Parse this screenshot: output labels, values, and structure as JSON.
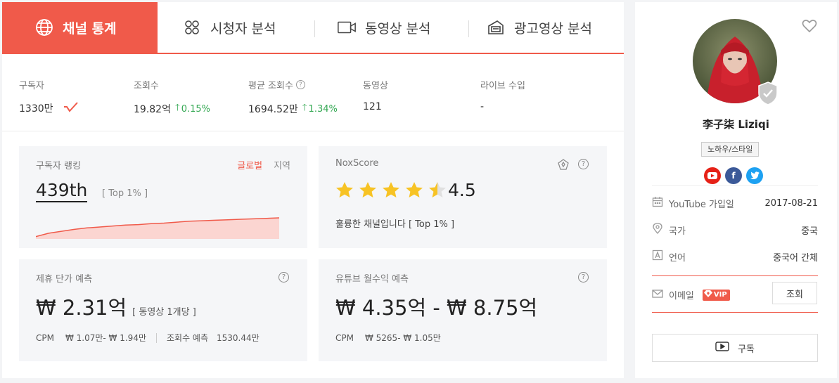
{
  "tabs": [
    {
      "label": "채널 통계",
      "icon": "globe-icon",
      "active": true
    },
    {
      "label": "시청자 분석",
      "icon": "audience-icon"
    },
    {
      "label": "동영상 분석",
      "icon": "video-icon"
    },
    {
      "label": "광고영상 분석",
      "icon": "ad-icon"
    }
  ],
  "stats": {
    "subscribers": {
      "label": "구독자",
      "value": "1330만"
    },
    "views": {
      "label": "조회수",
      "value": "19.82억",
      "change": "0.15%"
    },
    "avg_views": {
      "label": "평균 조회수",
      "value": "1694.52만",
      "change": "1.34%"
    },
    "videos": {
      "label": "동영상",
      "value": "121"
    },
    "live_income": {
      "label": "라이브 수입",
      "value": "-"
    }
  },
  "ranking": {
    "title": "구독자 랭킹",
    "global_label": "글로벌",
    "region_label": "지역",
    "rank": "439th",
    "top": "[ Top 1% ]",
    "trend": [
      2,
      9,
      13,
      17,
      20,
      22,
      24,
      26,
      27,
      29,
      30,
      32,
      34,
      35,
      36,
      37,
      38,
      39,
      40,
      41
    ]
  },
  "noxscore": {
    "title": "NoxScore",
    "rating": 4.5,
    "score_text": "4.5",
    "description": "훌륭한 채널입니다 [ Top 1% ]"
  },
  "sponsorship": {
    "title": "제휴 단가 예측",
    "price": "₩ 2.31억",
    "per": "[ 동영상 1개당 ]",
    "cpm_label": "CPM",
    "cpm_value": "₩ 1.07만- ₩ 1.94만",
    "views_label": "조회수 예측",
    "views_value": "1530.44만"
  },
  "revenue": {
    "title": "유튜브 월수익 예측",
    "price": "₩ 4.35억 - ₩ 8.75억",
    "cpm_label": "CPM",
    "cpm_value": "₩ 5265- ₩ 1.05만"
  },
  "profile": {
    "name": "李子柒 Liziqi",
    "category": "노하우/스타일",
    "joined_label": "YouTube 가입일",
    "joined_value": "2017-08-21",
    "country_label": "국가",
    "country_value": "중국",
    "language_label": "언어",
    "language_value": "중국어 간체",
    "email_label": "이메일",
    "vip_label": "VIP",
    "view_button": "조회",
    "subscribe_button": "구독"
  },
  "colors": {
    "accent": "#f05a4a",
    "up": "#34a853",
    "star": "#f7c325",
    "youtube": "#e62117",
    "facebook": "#3b5998",
    "twitter": "#1da1f2"
  }
}
